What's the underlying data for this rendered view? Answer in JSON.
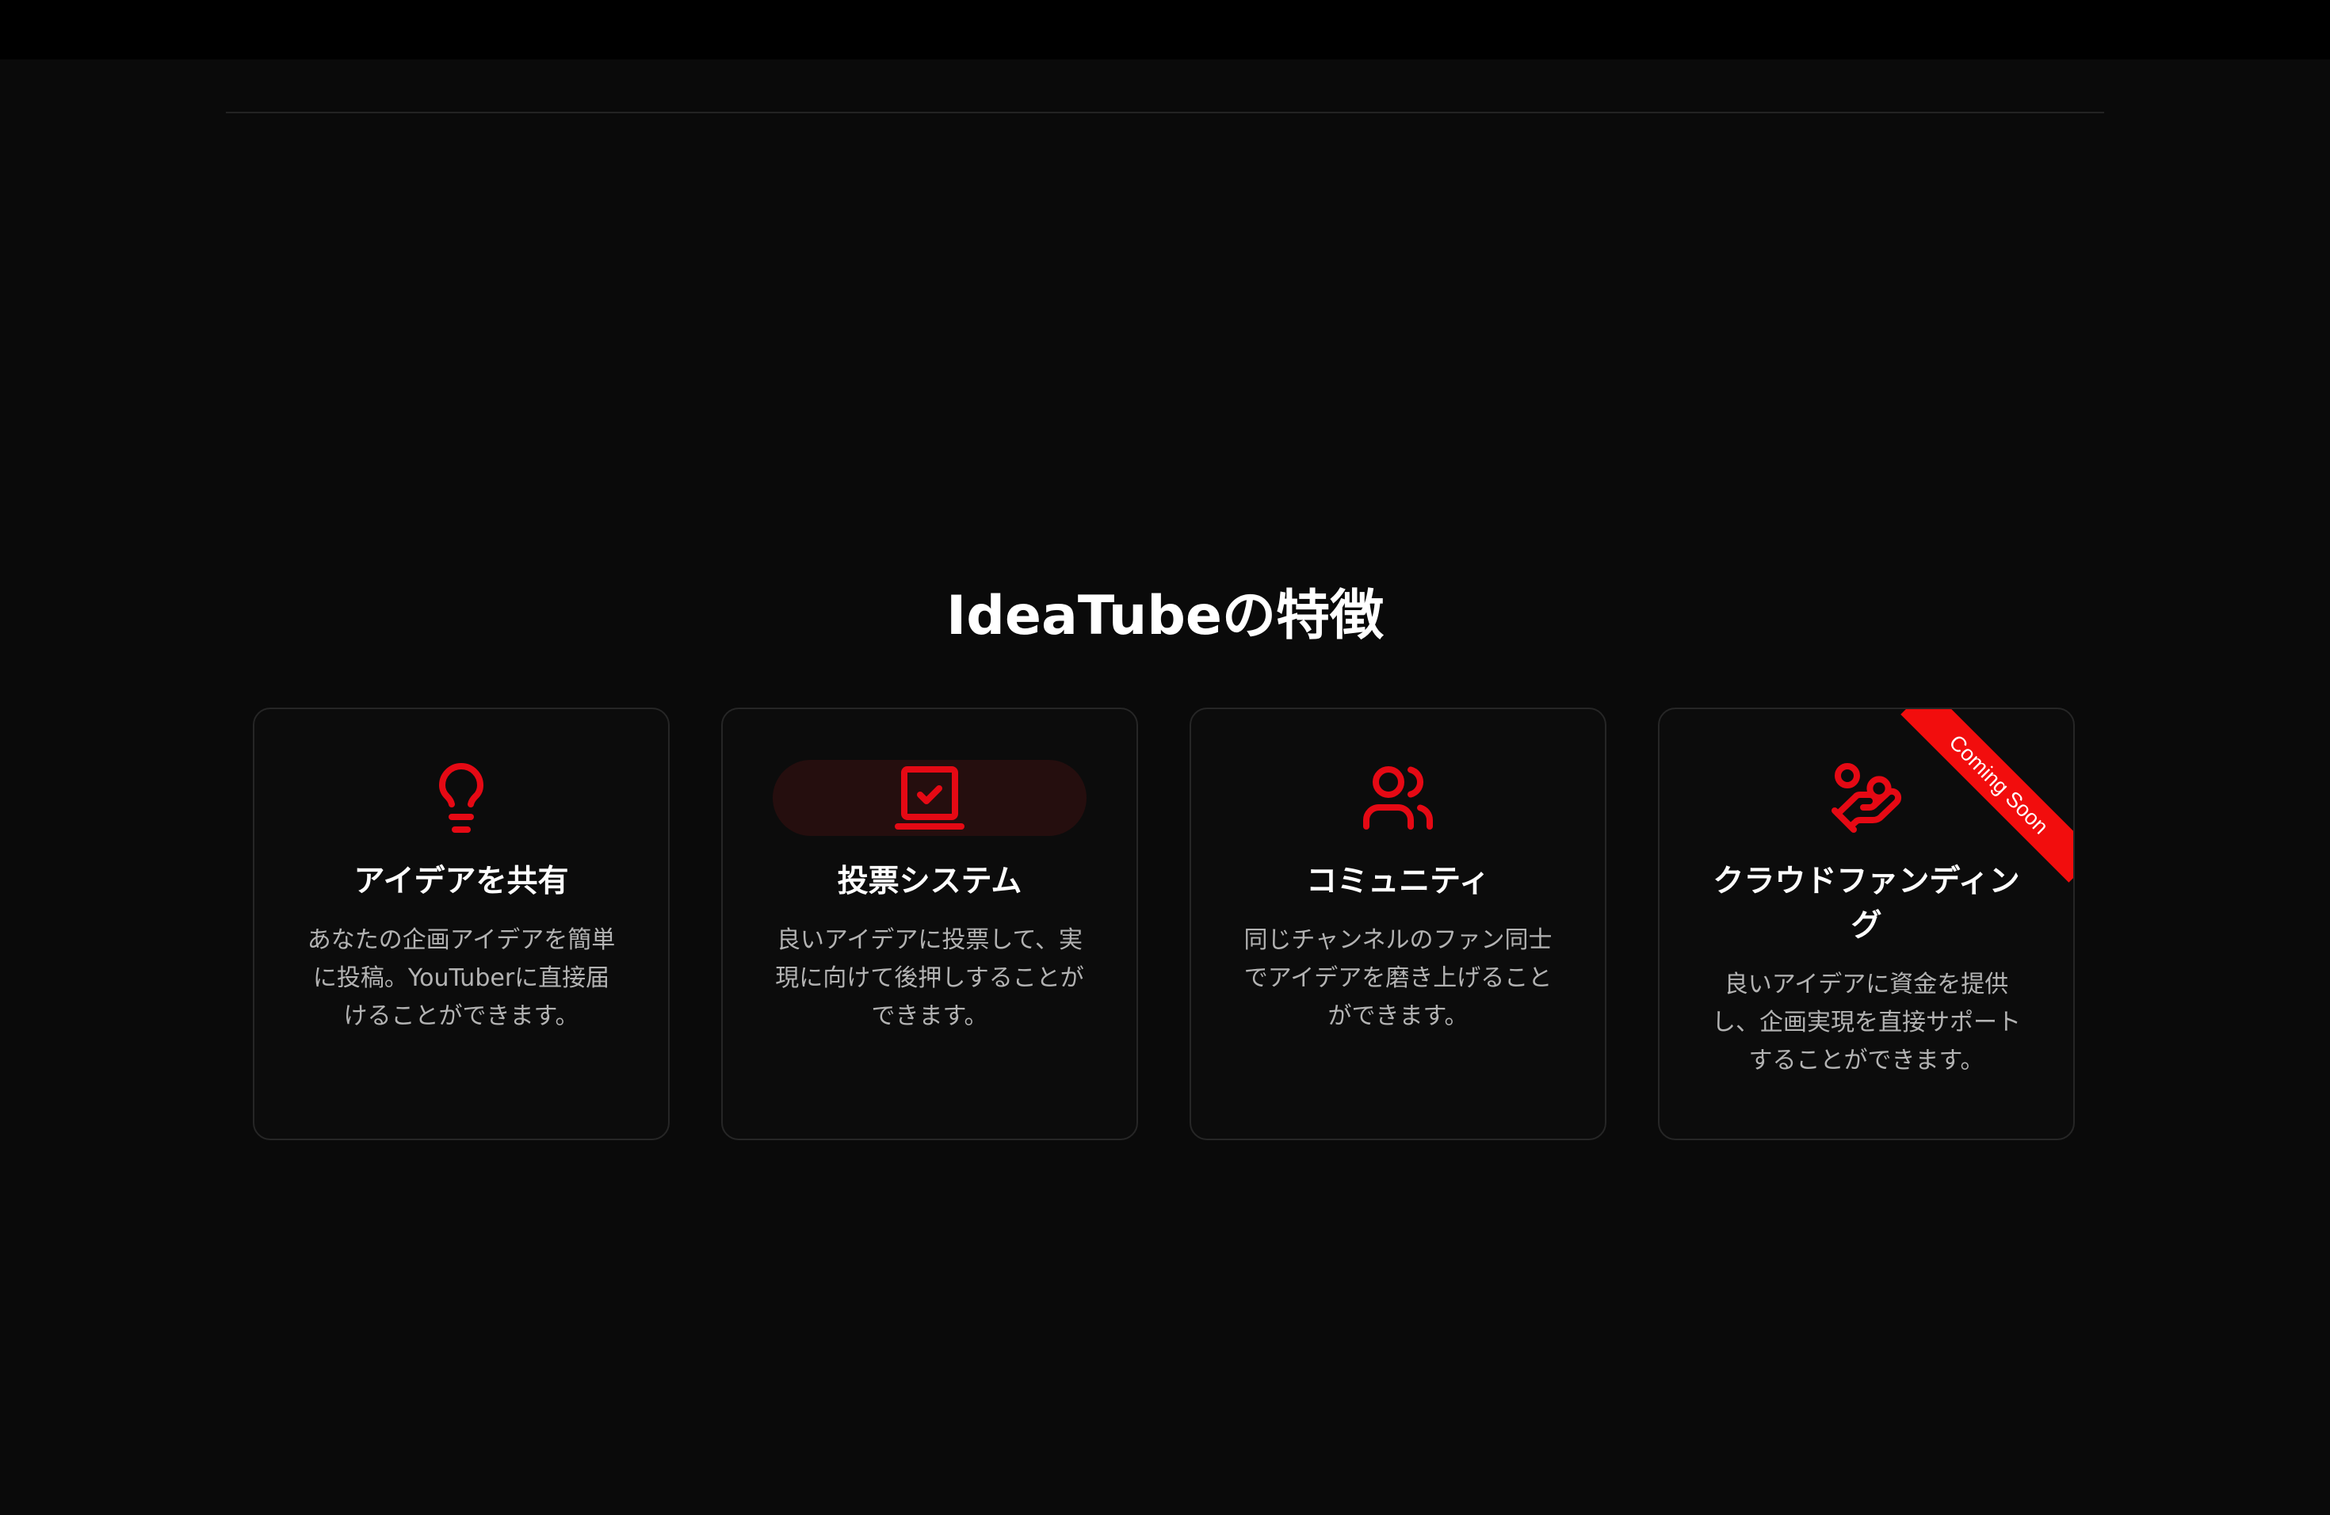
{
  "section": {
    "title": "IdeaTubeの特徴"
  },
  "colors": {
    "accent": "#e50914",
    "background": "#0a0a0a",
    "card_border": "#262626",
    "ribbon": "#f20d0d"
  },
  "features": [
    {
      "icon": "lightbulb-icon",
      "title": "アイデアを共有",
      "description": "あなたの企画アイデアを簡単に投稿。YouTuberに直接届けることができます。"
    },
    {
      "icon": "vote-laptop-check-icon",
      "title": "投票システム",
      "description": "良いアイデアに投票して、実現に向けて後押しすることができます。"
    },
    {
      "icon": "users-icon",
      "title": "コミュニティ",
      "description": "同じチャンネルのファン同士でアイデアを磨き上げることができます。"
    },
    {
      "icon": "hand-coins-icon",
      "title": "クラウドファンディング",
      "description": "良いアイデアに資金を提供し、企画実現を直接サポートすることができます。",
      "badge": "Coming Soon"
    }
  ]
}
